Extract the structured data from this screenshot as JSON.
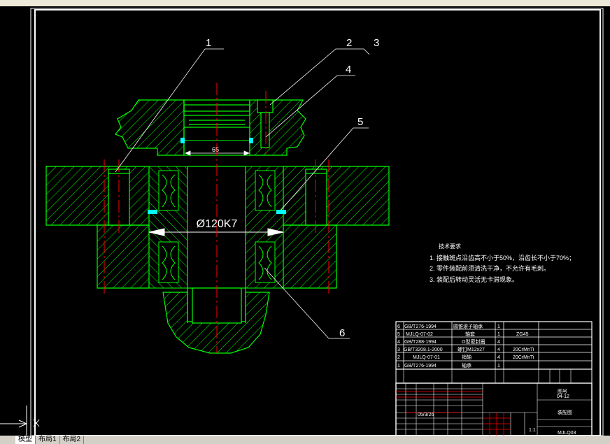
{
  "labels": {
    "p1": "1",
    "p2": "2",
    "p3": "3",
    "p4": "4",
    "p5": "5",
    "p6": "6",
    "dim_65": "65",
    "dim_bore": "Ø120K7"
  },
  "notes": {
    "title": "技术要求",
    "line1": "1. 接触斑点沿齿高不小于50%，沿齿长不小于70%；",
    "line2": "2. 零件装配前须清洗干净，不允许有毛刺。",
    "line3": "3. 装配后转动灵活无卡滞现象。"
  },
  "bom": [
    {
      "no": "6",
      "code": "GB/T276-1994",
      "name": "圆锥滚子轴承",
      "qty": "1",
      "mat": ""
    },
    {
      "no": "5",
      "code": "MJLQ-07-02",
      "name": "轴套",
      "qty": "1",
      "mat": "ZG45"
    },
    {
      "no": "4",
      "code": "GB/T288-1994",
      "name": "O型密封圈",
      "qty": "4",
      "mat": ""
    },
    {
      "no": "3",
      "code": "GB/T3208.1-2000",
      "name": "螺钉M12x27",
      "qty": "4",
      "mat": "20CrMnTi"
    },
    {
      "no": "2",
      "code": "MJLQ-07-01",
      "name": "销轴",
      "qty": "4",
      "mat": "20CrMnTi"
    },
    {
      "no": "1",
      "code": "GB/T276-1994",
      "name": "轴承",
      "qty": "1",
      "mat": ""
    }
  ],
  "title_block": {
    "drawing_no_label": "图号",
    "drawing_no": "04-12",
    "scale": "1:1",
    "part_name": "装配图",
    "code": "MJLQ03",
    "date": "05/3/26"
  },
  "tabs": {
    "model": "模型",
    "layout1": "布局1",
    "layout2": "布局2"
  },
  "colors": {
    "outline": "#00ff00",
    "hatch": "#00ff00",
    "centerline": "#ff0000",
    "leader": "#ffffff",
    "highlight": "#00ffff"
  }
}
